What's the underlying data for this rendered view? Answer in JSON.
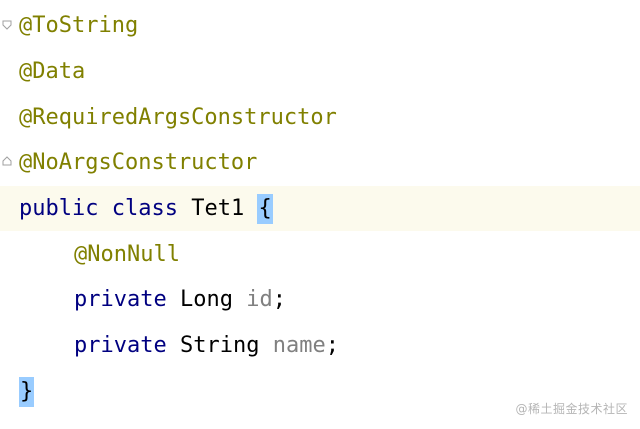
{
  "lines": {
    "l1": {
      "annotation": "@ToString"
    },
    "l2": {
      "annotation": "@Data"
    },
    "l3": {
      "annotation": "@RequiredArgsConstructor"
    },
    "l4": {
      "annotation": "@NoArgsConstructor"
    },
    "l5": {
      "kw1": "public",
      "kw2": "class",
      "name": "Tet1",
      "brace": "{"
    },
    "l6": {
      "annotation": "@NonNull"
    },
    "l7": {
      "kw": "private",
      "type": "Long",
      "field": "id",
      "semi": ";"
    },
    "l8": {
      "kw": "private",
      "type": "String",
      "field": "name",
      "semi": ";"
    },
    "l9": {
      "brace": "}"
    }
  },
  "watermark": "@稀土掘金技术社区",
  "colors": {
    "annotation": "#808000",
    "keyword": "#000080",
    "brace_highlight": "#99ccff",
    "current_line": "#fcfaed"
  }
}
